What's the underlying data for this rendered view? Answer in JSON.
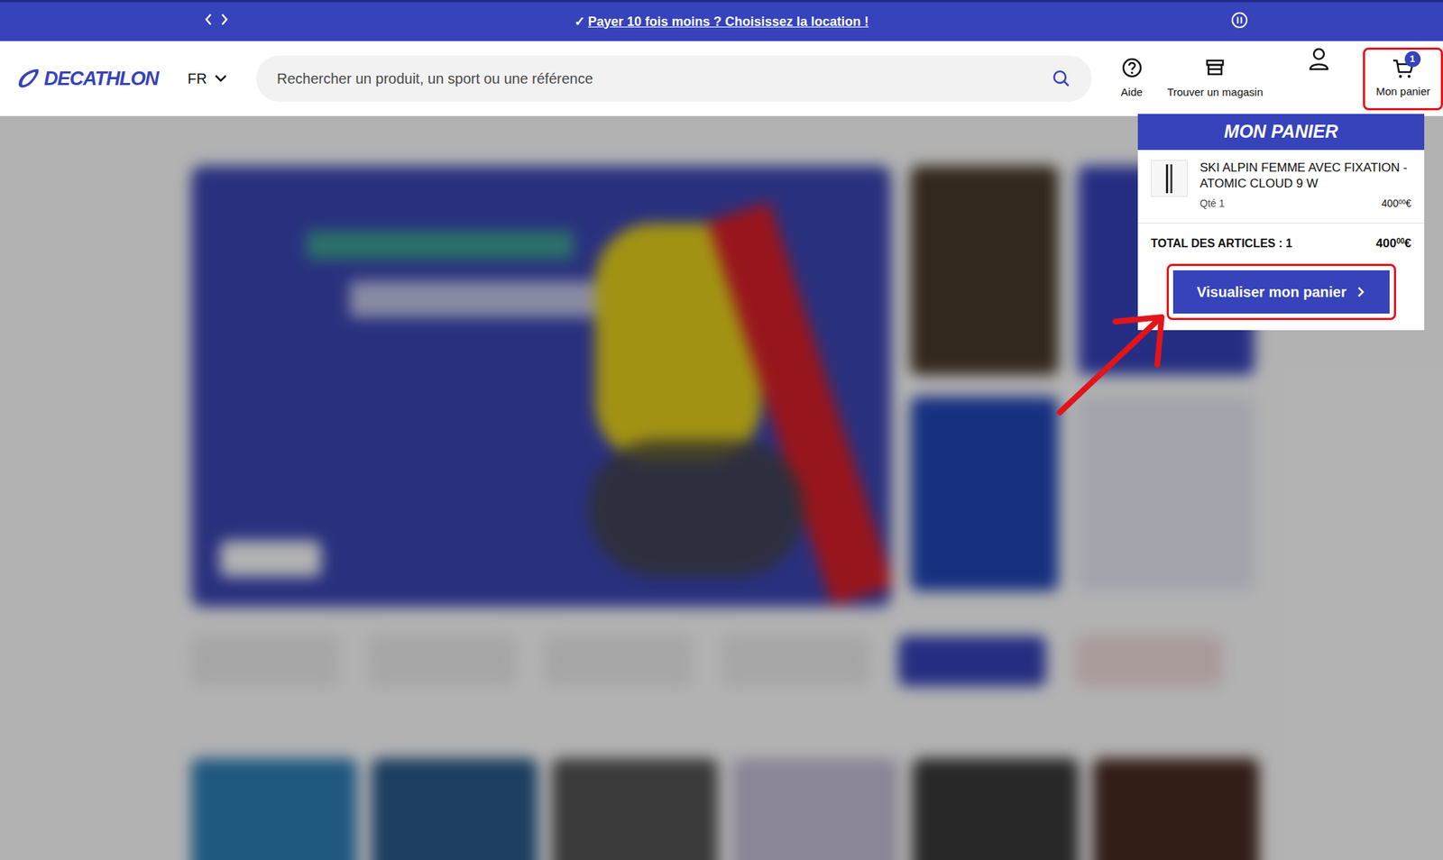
{
  "banner": {
    "check": "✓",
    "link": "Payer 10 fois moins ? Choisissez la location !"
  },
  "header": {
    "logo": "DECATHLON",
    "language": "FR",
    "search": {
      "placeholder": "Rechercher un produit, un sport ou une référence"
    },
    "help": "Aide",
    "stores": "Trouver un magasin",
    "cart": {
      "label": "Mon panier",
      "count": "1"
    }
  },
  "cart_popup": {
    "title": "MON PANIER",
    "items": [
      {
        "name": "SKI ALPIN FEMME AVEC FIXATION - ATOMIC CLOUD 9 W",
        "quantity": "Qté 1",
        "price": {
          "units": "400",
          "cents": "00",
          "currency": "€"
        }
      }
    ],
    "total_label": "TOTAL DES ARTICLES : 1",
    "total": {
      "units": "400",
      "cents": "00",
      "currency": "€"
    },
    "button": "Visualiser mon panier"
  }
}
